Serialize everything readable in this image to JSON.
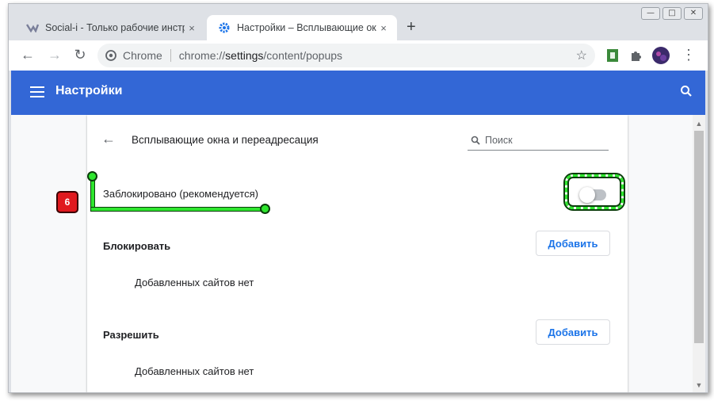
{
  "tabs": [
    {
      "title": "Social-i - Только рабочие инстр",
      "close": "×"
    },
    {
      "title": "Настройки – Всплывающие окн",
      "close": "×"
    }
  ],
  "new_tab": "+",
  "window_controls": {
    "minimize": "—",
    "maximize": "□",
    "close": "✕"
  },
  "toolbar": {
    "back": "←",
    "forward": "→",
    "reload": "↻",
    "menu": "⋮"
  },
  "omnibox": {
    "chip_label": "Chrome",
    "url_prefix": "chrome://",
    "url_host": "settings",
    "url_path": "/content/popups",
    "star": "☆"
  },
  "header": {
    "title": "Настройки"
  },
  "page": {
    "subtitle": "Всплывающие окна и переадресация",
    "search_placeholder": "Поиск",
    "blocked_label": "Заблокировано (рекомендуется)",
    "toggle_on": false,
    "block_section": {
      "title": "Блокировать",
      "button": "Добавить",
      "empty": "Добавленных сайтов нет"
    },
    "allow_section": {
      "title": "Разрешить",
      "button": "Добавить",
      "empty": "Добавленных сайтов нет"
    }
  },
  "annotation": {
    "step": "6"
  },
  "colors": {
    "header_bg": "#3367d6",
    "accent": "#1a73e8",
    "annotation": "#2ee62e",
    "badge": "#e0191e"
  }
}
